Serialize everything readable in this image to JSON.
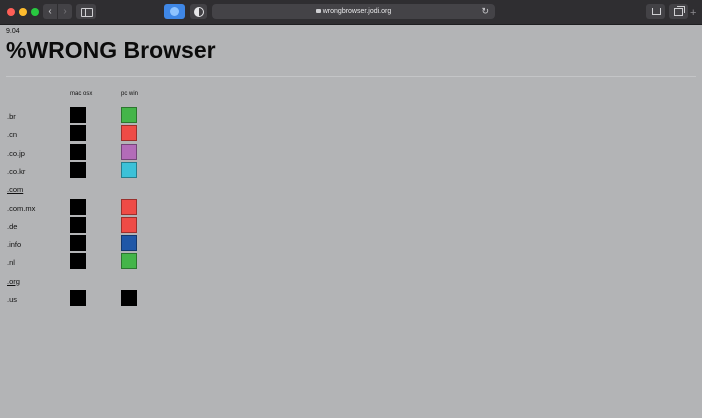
{
  "browser": {
    "url": "wrongbrowser.jodi.org",
    "back_glyph": "‹",
    "forward_glyph": "›",
    "new_tab": "+",
    "reload_glyph": "↻"
  },
  "page": {
    "version": "9.04",
    "title": "%WRONG Browser",
    "columns": [
      "mac osx",
      "pc win"
    ],
    "rows": [
      {
        "domain": ".br",
        "link": false,
        "mac": "#000000",
        "pc": "#44b549"
      },
      {
        "domain": ".cn",
        "link": false,
        "mac": "#000000",
        "pc": "#ef4b46"
      },
      {
        "domain": ".co.jp",
        "link": false,
        "mac": "#000000",
        "pc": "#b36cb8"
      },
      {
        "domain": ".co.kr",
        "link": false,
        "mac": "#000000",
        "pc": "#3cc1d8"
      },
      {
        "domain": ".com",
        "link": true,
        "mac": null,
        "pc": null
      },
      {
        "domain": ".com.mx",
        "link": false,
        "mac": "#000000",
        "pc": "#ef4b46"
      },
      {
        "domain": ".de",
        "link": false,
        "mac": "#000000",
        "pc": "#ef4b46"
      },
      {
        "domain": ".info",
        "link": false,
        "mac": "#000000",
        "pc": "#1f57a7"
      },
      {
        "domain": ".nl",
        "link": false,
        "mac": "#000000",
        "pc": "#44b549"
      },
      {
        "domain": ".org",
        "link": true,
        "mac": null,
        "pc": null
      },
      {
        "domain": ".us",
        "link": false,
        "mac": "#000000",
        "pc": "#000000"
      }
    ]
  }
}
